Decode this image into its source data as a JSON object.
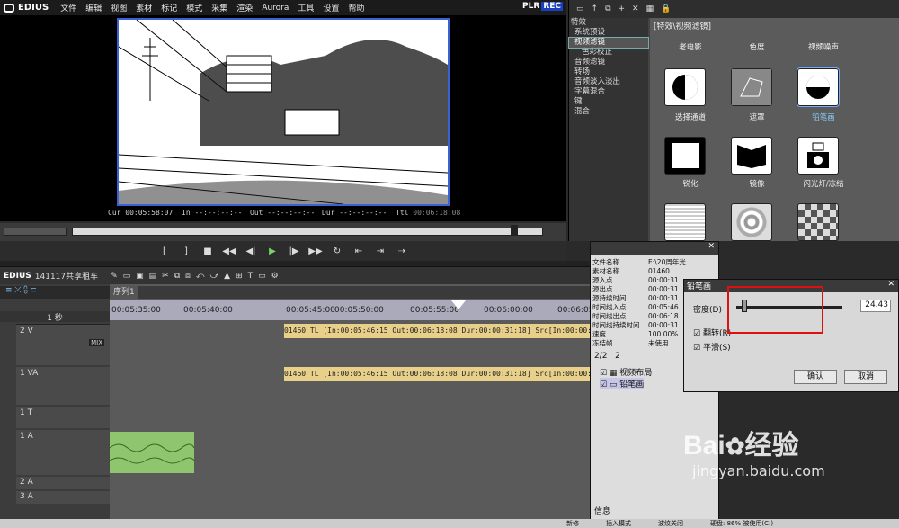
{
  "app": {
    "name": "EDIUS",
    "plr": "PLR",
    "rec": "REC"
  },
  "menu": [
    "文件",
    "编辑",
    "视图",
    "素材",
    "标记",
    "模式",
    "采集",
    "渲染",
    "Aurora",
    "工具",
    "设置",
    "帮助"
  ],
  "timecode": {
    "cur_label": "Cur",
    "cur": "00:05:58:07",
    "in_label": "In",
    "in": "--:--:--:--",
    "out_label": "Out",
    "out": "--:--:--:--",
    "dur_label": "Dur",
    "dur": "--:--:--:--",
    "ttl_label": "Ttl",
    "ttl": "00:06:18:08"
  },
  "effects": {
    "breadcrumb": "[特效\\视频滤镜]",
    "panel_title": "特效",
    "tree": [
      "系统预设",
      "视频滤镜",
      "色彩校正",
      "音频滤镜",
      "转场",
      "音频淡入淡出",
      "字幕混合",
      "键",
      "混合"
    ],
    "tiles": [
      {
        "label": "老电影"
      },
      {
        "label": "色度"
      },
      {
        "label": "视频噪声"
      },
      {
        "label": "选择通道"
      },
      {
        "label": "遮罩"
      },
      {
        "label": "铅笔画",
        "selected": true
      },
      {
        "label": "锐化"
      },
      {
        "label": "镜像"
      },
      {
        "label": "闪光灯/冻结"
      }
    ]
  },
  "project": {
    "name": "141117共享租车",
    "sequence_tab": "序列1",
    "scale": "1 秒"
  },
  "ruler": [
    "00:05:35:00",
    "00:05:40:00",
    "00:05:45:00",
    "00:05:50:00",
    "00:05:55:00",
    "00:06:00:00",
    "00:06:05:00"
  ],
  "tracks": [
    {
      "name": "2 V",
      "type": "video"
    },
    {
      "name": "1 VA",
      "type": "va"
    },
    {
      "name": "1 T",
      "type": "title"
    },
    {
      "name": "1 A",
      "type": "audio"
    },
    {
      "name": "2 A",
      "type": "audio"
    },
    {
      "name": "3 A",
      "type": "audio"
    }
  ],
  "clip": {
    "text": "01460  TL [In:00:05:46:15 Out:00:06:18:08 Dur:00:00:31:18]  Src[In:00:00:00:00"
  },
  "mix_label": "MIX",
  "info": {
    "rows": [
      [
        "文件名称",
        "E:\\20周年光..."
      ],
      [
        "素材名称",
        "01460"
      ],
      [
        "源入点",
        "00:00:31"
      ],
      [
        "源出点",
        "00:00:31"
      ],
      [
        "源持续时间",
        "00:00:31"
      ],
      [
        "时间线入点",
        "00:05:46"
      ],
      [
        "时间线出点",
        "00:06:18"
      ],
      [
        "时间线持续时间",
        "00:00:31"
      ],
      [
        "速度",
        "100.00%"
      ],
      [
        "冻结帧",
        "未使用"
      ]
    ],
    "count": "2/2",
    "count2": "2",
    "effects_list": [
      "视频布局",
      "铅笔画"
    ],
    "footer": "信息"
  },
  "dialog": {
    "title": "铅笔画",
    "density_label": "密度(D)",
    "density_value": "24.43",
    "reverse_label": "翻转(R)",
    "smooth_label": "平滑(S)",
    "ok": "确认",
    "cancel": "取消",
    "density_level": 0.05
  },
  "statusbar": {
    "items": [
      "新修",
      "插入模式",
      "波纹关闭",
      "硬盘: 86% 被使用(C:)"
    ]
  },
  "watermark": {
    "brand": "Bai",
    "brand2": "经验",
    "url": "jingyan.baidu.com"
  },
  "colors": {
    "accent": "#3a62d6",
    "clip": "#e8d08a",
    "audio": "#8fc56f",
    "playhead": "#6fd0ff",
    "highlight": "#d11"
  }
}
